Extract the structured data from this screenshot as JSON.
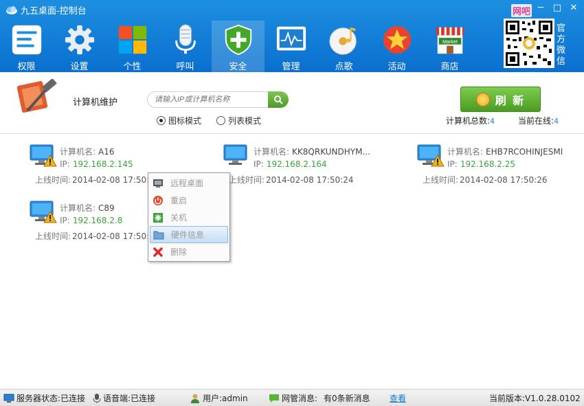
{
  "window": {
    "title": "九五桌面-控制台",
    "badge": "网吧"
  },
  "toolbar": {
    "items": [
      {
        "label": "权限",
        "icon": "permissions-icon"
      },
      {
        "label": "设置",
        "icon": "gear-icon"
      },
      {
        "label": "个性",
        "icon": "windows-tiles-icon"
      },
      {
        "label": "呼叫",
        "icon": "microphone-icon"
      },
      {
        "label": "安全",
        "icon": "shield-plus-icon",
        "active": true
      },
      {
        "label": "管理",
        "icon": "monitor-graph-icon"
      },
      {
        "label": "点歌",
        "icon": "music-disc-icon"
      },
      {
        "label": "活动",
        "icon": "star-badge-icon"
      },
      {
        "label": "商店",
        "icon": "market-icon"
      }
    ],
    "official_wechat": "官方微信",
    "market_sign": "Market"
  },
  "header": {
    "title": "计算机维护",
    "search_placeholder": "请输入IP或计算机名称",
    "view_icon": "图标模式",
    "view_list": "列表模式",
    "refresh": "刷 新",
    "total_label": "计算机总数:",
    "total_value": "4",
    "online_label": "当前在线:",
    "online_value": "4"
  },
  "labels": {
    "name": "计算机名:",
    "ip": "IP:",
    "online_time": "上线时间:"
  },
  "computers": [
    {
      "name": "A16",
      "ip": "192.168.2.145",
      "time": "2014-02-08 17:50:24"
    },
    {
      "name": "KK8QRKUNDHYM...",
      "ip": "192.168.2.164",
      "time": "2014-02-08 17:50:24"
    },
    {
      "name": "EHB7RCOHINJESMI",
      "ip": "192.168.2.25",
      "time": "2014-02-08 17:50:26"
    },
    {
      "name": "C89",
      "ip": "192.168.2.8",
      "time": "2014-02-08 17:50:24"
    }
  ],
  "context_menu": {
    "items": [
      {
        "label": "远程桌面",
        "icon": "remote-desktop-icon"
      },
      {
        "label": "重启",
        "icon": "restart-icon"
      },
      {
        "label": "关机",
        "icon": "shutdown-icon"
      },
      {
        "label": "硬件信息",
        "icon": "folder-icon",
        "hover": true
      },
      {
        "label": "删除",
        "icon": "delete-icon"
      }
    ]
  },
  "statusbar": {
    "server": "服务器状态:已连接",
    "voice": "语音端:已连接",
    "user": "用户:admin",
    "msg_label": "网管消息:",
    "msg_value": "有0条新消息",
    "view_link": "查看",
    "version": "当前版本:V1.0.28.0102"
  },
  "colors": {
    "title_bar": "#0a6fcf",
    "ip_text": "#3aa43a",
    "refresh_green": "#5aae30",
    "link": "#1a7ec9"
  }
}
